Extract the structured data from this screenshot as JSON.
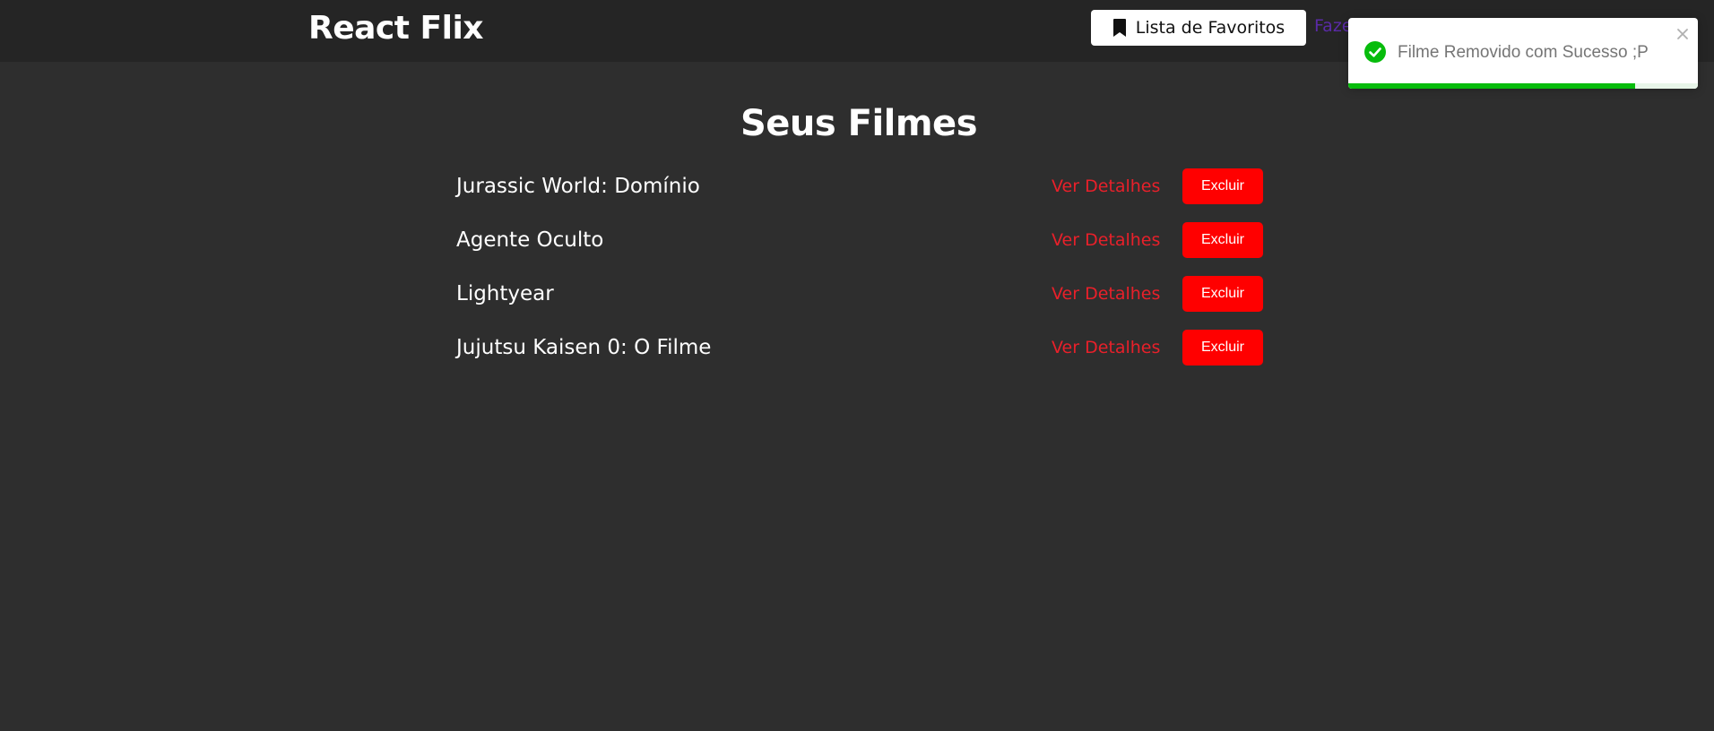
{
  "header": {
    "logo": "React Flix",
    "favorites_button_label": "Lista de Favoritos",
    "partial_nav_link": "Fazer"
  },
  "main": {
    "title": "Seus Filmes",
    "details_label": "Ver Detalhes",
    "delete_label": "Excluir",
    "movies": [
      {
        "title": "Jurassic World: Domínio"
      },
      {
        "title": "Agente Oculto"
      },
      {
        "title": "Lightyear"
      },
      {
        "title": "Jujutsu Kaisen 0: O Filme"
      }
    ]
  },
  "toast": {
    "message": "Filme Removido com Sucesso ;P",
    "type": "success",
    "progress": 0.82,
    "icon": "check-circle-icon"
  },
  "colors": {
    "background": "#2e2e2e",
    "header": "#252525",
    "accent_red": "#ff0000",
    "details_link": "#e8202a",
    "toast_success": "#07bc0c",
    "nav_link": "#5a2aa6"
  }
}
